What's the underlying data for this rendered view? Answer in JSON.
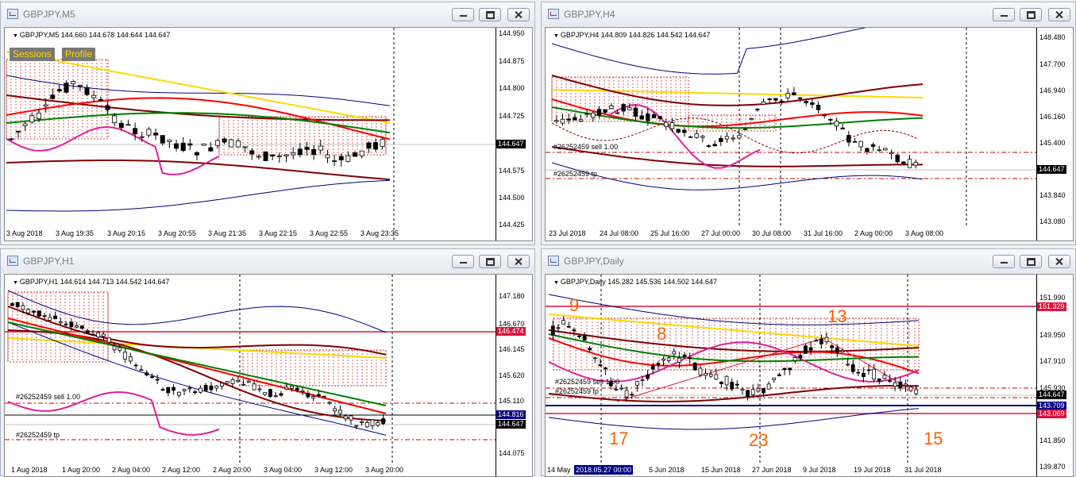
{
  "windows": {
    "m5": {
      "title": "GBPJPY,M5",
      "header": "GBPJPY,M5  144.660 144.678 144.644 144.647",
      "sessions_button": "Sessions",
      "profile_button": "Profile",
      "price_labels": [
        "144.950",
        "144.875",
        "144.800",
        "144.725",
        "144.650",
        "144.575",
        "144.500",
        "144.425"
      ],
      "current_price": "144.647",
      "time_labels": [
        "3 Aug 2018",
        "3 Aug 19:35",
        "3 Aug 20:15",
        "3 Aug 20:55",
        "3 Aug 21:35",
        "3 Aug 22:15",
        "3 Aug 22:55",
        "3 Aug 23:35"
      ]
    },
    "h4": {
      "title": "GBPJPY,H4",
      "header": "GBPJPY,H4  144.809 144.826 144.542 144.647",
      "price_labels": [
        "148.480",
        "147.700",
        "146.940",
        "146.160",
        "145.400",
        "144.620",
        "143.840",
        "143.080"
      ],
      "current_price": "144.647",
      "order_sell": "#26252459 sell 1.00",
      "order_tp": "#26252459 tp",
      "time_labels": [
        "23 Jul 2018",
        "24 Jul 08:00",
        "25 Jul 16:00",
        "27 Jul 00:00",
        "30 Jul 08:00",
        "31 Jul 16:00",
        "2 Aug 00:00",
        "3 Aug 08:00"
      ]
    },
    "h1": {
      "title": "GBPJPY,H1",
      "header": "GBPJPY,H1  144.614 144.713 144.542 144.647",
      "price_labels": [
        "147.180",
        "146.670",
        "146.145",
        "145.620",
        "145.110",
        "144.590",
        "144.075"
      ],
      "level_tag": "146.474",
      "tag_upper": "144.816",
      "current_price": "144.647",
      "order_sell": "#26252459 sell 1.00",
      "order_tp": "#26252459 tp",
      "time_labels": [
        "1 Aug 2018",
        "1 Aug 20:00",
        "2 Aug 04:00",
        "2 Aug 12:00",
        "2 Aug 20:00",
        "3 Aug 04:00",
        "3 Aug 12:00",
        "3 Aug 20:00"
      ]
    },
    "daily": {
      "title": "GBPJPY,Daily",
      "header": "GBPJPY,Daily  145.282 145.536 144.502 144.647",
      "price_labels": [
        "151.990",
        "149.950",
        "147.910",
        "145.930",
        "143.890",
        "141.850",
        "139.870"
      ],
      "tag_red_top": "151.329",
      "current_price": "144.647",
      "tag_blue": "143.709",
      "tag_red_bottom": "143.069",
      "order_sell": "#26252459 sell 1.00",
      "order_tp": "#26252459 tp",
      "wave_labels": [
        "9",
        "8",
        "13",
        "17",
        "23",
        "15"
      ],
      "time_cursor": "2018.05.27 00:00",
      "time_labels": [
        "14 May",
        "5 Jun 2018",
        "15 Jun 2018",
        "27 Jun 2018",
        "9 Jul 2018",
        "19 Jul 2018",
        "31 Jul 2018"
      ]
    }
  },
  "colors": {
    "bull_candle": "#ffffff",
    "bear_candle": "#000000",
    "ma_red": "#ff0000",
    "ma_green": "#008000",
    "ma_darkred": "#800000",
    "ma_yellow": "#ffd700",
    "band_navy": "#000080",
    "oscillator_magenta": "#e0209a",
    "session_dotted": "#c00000",
    "wave_orange": "#ff6000",
    "tag_red": "#dc143c",
    "tag_navy": "#000080"
  }
}
